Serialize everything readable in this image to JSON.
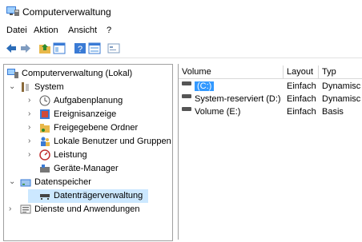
{
  "window": {
    "title": "Computerverwaltung"
  },
  "menu": [
    "Datei",
    "Aktion",
    "Ansicht",
    "?"
  ],
  "toolbar": {
    "icons": [
      "back-arrow-icon",
      "forward-arrow-icon",
      "up-folder-icon",
      "show-tree-icon",
      "help-icon",
      "properties-icon",
      "console-icon"
    ]
  },
  "tree": {
    "root": "Computerverwaltung (Lokal)",
    "system": "System",
    "aufgabenplanung": "Aufgabenplanung",
    "ereignisanzeige": "Ereignisanzeige",
    "freigegebene_ordner": "Freigegebene Ordner",
    "lokale_benutzer": "Lokale Benutzer und Gruppen",
    "leistung": "Leistung",
    "geraete_manager": "Geräte-Manager",
    "datenspeicher": "Datenspeicher",
    "datentraegerverwaltung": "Datenträgerverwaltung",
    "dienste": "Dienste und Anwendungen"
  },
  "table": {
    "headers": [
      "Volume",
      "Layout",
      "Typ"
    ],
    "rows": [
      {
        "volume": "(C:)",
        "layout": "Einfach",
        "typ": "Dynamisc"
      },
      {
        "volume": "System-reserviert (D:)",
        "layout": "Einfach",
        "typ": "Dynamisc"
      },
      {
        "volume": "Volume (E:)",
        "layout": "Einfach",
        "typ": "Basis"
      }
    ]
  },
  "colors": {
    "selection": "#cce8ff",
    "volume_highlight": "#3399ff",
    "accent": "#2b6cb8"
  }
}
